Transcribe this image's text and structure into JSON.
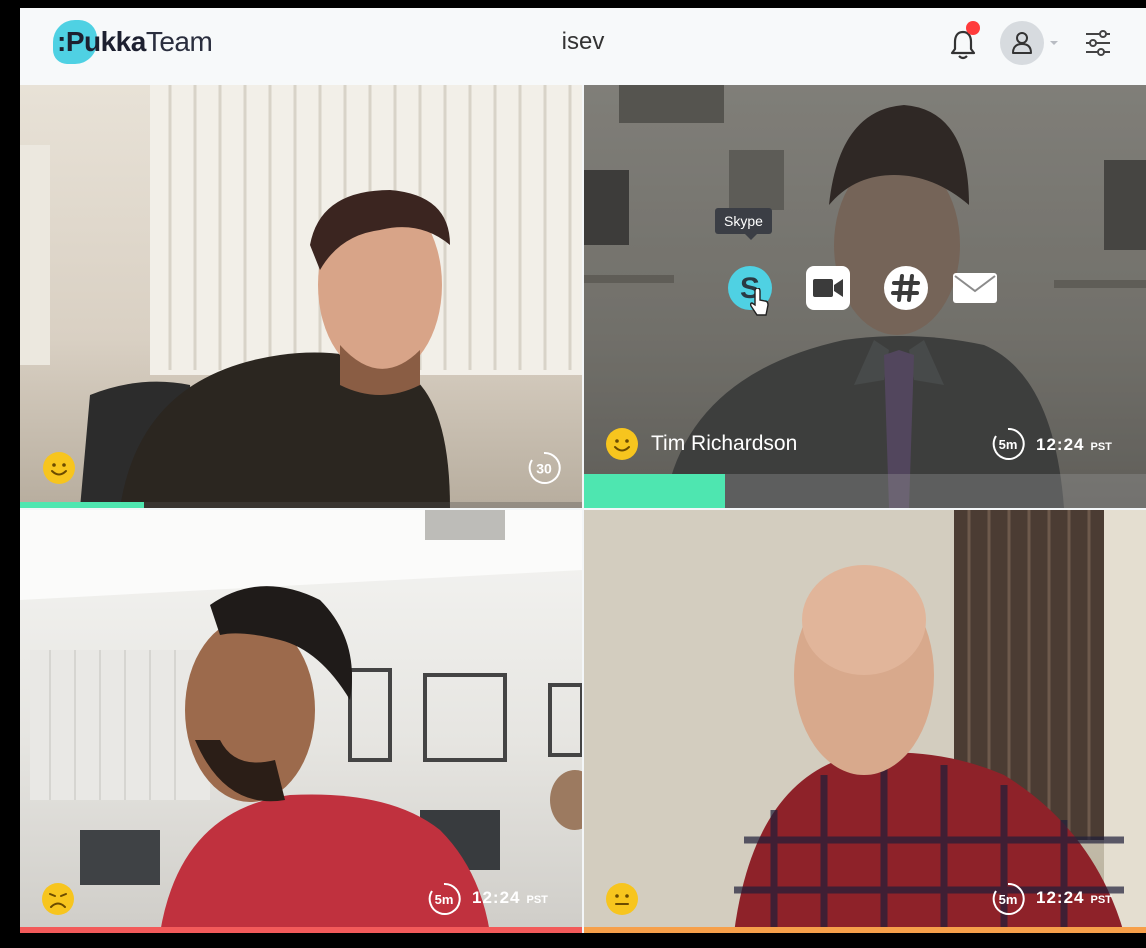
{
  "header": {
    "logo_bold": ":Pukka",
    "logo_light": "Team",
    "title": "isev",
    "notification_dot_color": "#ff3b3b",
    "brand_color": "#4fd1e3"
  },
  "tiles": [
    {
      "mood": "happy",
      "timer_label": "30",
      "progress_fraction": 0.22,
      "progress_color": "#4ee6b0"
    },
    {
      "name": "Tim Richardson",
      "mood": "happy",
      "timer_label": "5m",
      "time": "12:24",
      "timezone": "PST",
      "progress_fraction": 0.25,
      "progress_color": "#4ee6b0",
      "tooltip": "Skype",
      "actions": [
        "skype-icon",
        "video-icon",
        "slack-icon",
        "email-icon"
      ]
    },
    {
      "mood": "sad",
      "timer_label": "5m",
      "time": "12:24",
      "timezone": "PST",
      "progress_fraction": 1.0,
      "progress_color": "#f35a5a"
    },
    {
      "mood": "neutral",
      "timer_label": "5m",
      "time": "12:24",
      "timezone": "PST",
      "progress_fraction": 1.0,
      "progress_color": "#f7a04a"
    }
  ]
}
